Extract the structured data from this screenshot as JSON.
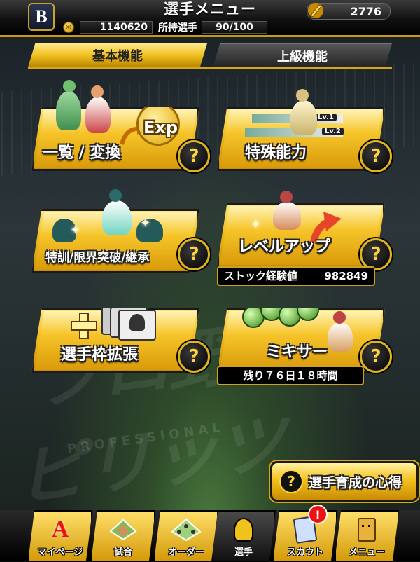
{
  "header": {
    "title": "選手メニュー",
    "team_logo": "B",
    "currency_value": "2776",
    "coins": "1140620",
    "players_label": "所持選手",
    "players_count": "90/100"
  },
  "tabs": [
    {
      "label": "基本機能",
      "active": true
    },
    {
      "label": "上級機能",
      "active": false
    }
  ],
  "menu": {
    "list_convert": {
      "label": "一覧 / 変換",
      "badge": "Exp"
    },
    "special_ability": {
      "label": "特殊能力",
      "lv1": "Lv.1",
      "lv2": "Lv.2"
    },
    "training": {
      "label": "特訓/限界突破/継承"
    },
    "level_up": {
      "label": "レベルアップ",
      "stock_label": "ストック経験値",
      "stock_value": "982849"
    },
    "expand_slots": {
      "label": "選手枠拡張"
    },
    "mixer": {
      "label": "ミキサー",
      "remaining": "残り７６日１８時間"
    }
  },
  "help_symbol": "?",
  "tips": {
    "label": "選手育成の心得"
  },
  "background": {
    "logo_text": "プロ野球スピリッツ",
    "sub_text": "PROFESSIONAL"
  },
  "nav": [
    {
      "label": "マイページ",
      "icon": "A"
    },
    {
      "label": "試合",
      "icon": "field-icon"
    },
    {
      "label": "オーダー",
      "icon": "lineup-icon"
    },
    {
      "label": "選手",
      "icon": "player-icon"
    },
    {
      "label": "スカウト",
      "icon": "scout-icon"
    },
    {
      "label": "メニュー",
      "icon": "menu-icon"
    }
  ],
  "scout_alert": "!",
  "colors": {
    "gold": "#f2bb1c",
    "dark": "#111111",
    "alert": "#ee1111"
  }
}
